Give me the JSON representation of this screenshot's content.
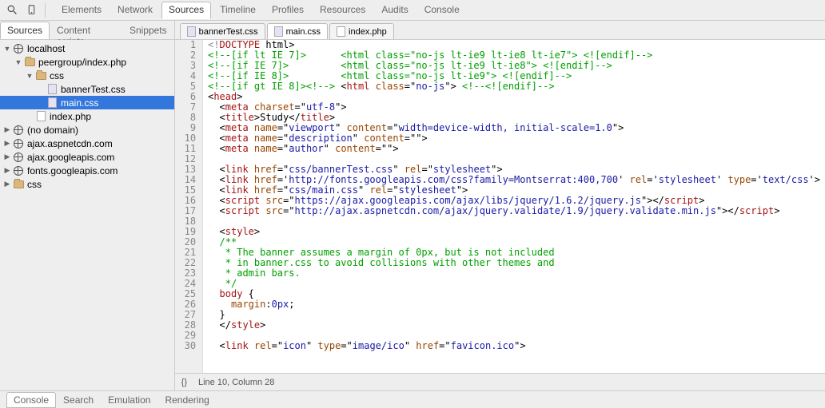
{
  "toolbar": {
    "tabs": [
      "Elements",
      "Network",
      "Sources",
      "Timeline",
      "Profiles",
      "Resources",
      "Audits",
      "Console"
    ],
    "active": 2
  },
  "sidebar": {
    "tabs": [
      "Sources",
      "Content scripts",
      "Snippets"
    ],
    "active": 0,
    "tree": [
      {
        "t": "▼",
        "i": "world",
        "d": 0,
        "l": "localhost"
      },
      {
        "t": "▼",
        "i": "fold",
        "d": 1,
        "l": "peergroup/index.php"
      },
      {
        "t": "▼",
        "i": "fold",
        "d": 2,
        "l": "css"
      },
      {
        "t": "",
        "i": "css",
        "d": 3,
        "l": "bannerTest.css"
      },
      {
        "t": "",
        "i": "css",
        "d": 3,
        "l": "main.css",
        "sel": true
      },
      {
        "t": "",
        "i": "file",
        "d": 2,
        "l": "index.php"
      },
      {
        "t": "▶",
        "i": "world",
        "d": 0,
        "l": "(no domain)"
      },
      {
        "t": "▶",
        "i": "world",
        "d": 0,
        "l": "ajax.aspnetcdn.com"
      },
      {
        "t": "▶",
        "i": "world",
        "d": 0,
        "l": "ajax.googleapis.com"
      },
      {
        "t": "▶",
        "i": "world",
        "d": 0,
        "l": "fonts.googleapis.com"
      },
      {
        "t": "▶",
        "i": "fold",
        "d": 0,
        "l": "css"
      }
    ]
  },
  "fileTabs": [
    {
      "label": "bannerTest.css",
      "icon": "css"
    },
    {
      "label": "main.css",
      "icon": "css",
      "active": true
    },
    {
      "label": "index.php",
      "icon": "file"
    }
  ],
  "code": {
    "lines": [
      [
        [
          "doc",
          "<!"
        ],
        [
          "tag",
          "DOCTYPE"
        ],
        [
          "",
          ""
        ],
        [
          "",
          " html>"
        ]
      ],
      [
        [
          "com",
          "<!--[if lt IE 7]>      <html class=\"no-js lt-ie9 lt-ie8 lt-ie7\"> <![endif]-->"
        ]
      ],
      [
        [
          "com",
          "<!--[if IE 7]>         <html class=\"no-js lt-ie9 lt-ie8\"> <![endif]-->"
        ]
      ],
      [
        [
          "com",
          "<!--[if IE 8]>         <html class=\"no-js lt-ie9\"> <![endif]-->"
        ]
      ],
      [
        [
          "com",
          "<!--[if gt IE 8]><!-->"
        ],
        [
          "",
          " <"
        ],
        [
          "tag",
          "html"
        ],
        [
          "",
          " "
        ],
        [
          "at",
          "class"
        ],
        [
          "",
          "=\""
        ],
        [
          "str",
          "no-js"
        ],
        [
          "",
          "\"> "
        ],
        [
          "com",
          "<!--<![endif]-->"
        ]
      ],
      [
        [
          "",
          "<"
        ],
        [
          "tag",
          "head"
        ],
        [
          "",
          ">"
        ]
      ],
      [
        [
          "",
          "  <"
        ],
        [
          "tag",
          "meta"
        ],
        [
          "",
          " "
        ],
        [
          "at",
          "charset"
        ],
        [
          "",
          "=\""
        ],
        [
          "str",
          "utf-8"
        ],
        [
          "",
          "\">"
        ]
      ],
      [
        [
          "",
          "  <"
        ],
        [
          "tag",
          "title"
        ],
        [
          "",
          ">Study</"
        ],
        [
          "tag",
          "title"
        ],
        [
          "",
          ">"
        ]
      ],
      [
        [
          "",
          "  <"
        ],
        [
          "tag",
          "meta"
        ],
        [
          "",
          " "
        ],
        [
          "at",
          "name"
        ],
        [
          "",
          "=\""
        ],
        [
          "str",
          "viewport"
        ],
        [
          "",
          "\" "
        ],
        [
          "at",
          "content"
        ],
        [
          "",
          "=\""
        ],
        [
          "str",
          "width=device-width, initial-scale=1.0"
        ],
        [
          "",
          "\">"
        ]
      ],
      [
        [
          "",
          "  <"
        ],
        [
          "tag",
          "meta"
        ],
        [
          "",
          " "
        ],
        [
          "at",
          "name"
        ],
        [
          "",
          "=\""
        ],
        [
          "str",
          "description"
        ],
        [
          "",
          "\" "
        ],
        [
          "at",
          "content"
        ],
        [
          "",
          "=\"\">"
        ]
      ],
      [
        [
          "",
          "  <"
        ],
        [
          "tag",
          "meta"
        ],
        [
          "",
          " "
        ],
        [
          "at",
          "name"
        ],
        [
          "",
          "=\""
        ],
        [
          "str",
          "author"
        ],
        [
          "",
          "\" "
        ],
        [
          "at",
          "content"
        ],
        [
          "",
          "=\"\">"
        ]
      ],
      [
        [
          "",
          ""
        ]
      ],
      [
        [
          "",
          "  <"
        ],
        [
          "tag",
          "link"
        ],
        [
          "",
          " "
        ],
        [
          "at",
          "href"
        ],
        [
          "",
          "=\""
        ],
        [
          "str",
          "css/bannerTest.css"
        ],
        [
          "",
          "\" "
        ],
        [
          "at",
          "rel"
        ],
        [
          "",
          "=\""
        ],
        [
          "str",
          "stylesheet"
        ],
        [
          "",
          "\">"
        ]
      ],
      [
        [
          "",
          "  <"
        ],
        [
          "tag",
          "link"
        ],
        [
          "",
          " "
        ],
        [
          "at",
          "href"
        ],
        [
          "",
          "='"
        ],
        [
          "str",
          "http://fonts.googleapis.com/css?family=Montserrat:400,700"
        ],
        [
          "",
          "' "
        ],
        [
          "at",
          "rel"
        ],
        [
          "",
          "='"
        ],
        [
          "str",
          "stylesheet"
        ],
        [
          "",
          "' "
        ],
        [
          "at",
          "type"
        ],
        [
          "",
          "='"
        ],
        [
          "str",
          "text/css"
        ],
        [
          "",
          "'>"
        ]
      ],
      [
        [
          "",
          "  <"
        ],
        [
          "tag",
          "link"
        ],
        [
          "",
          " "
        ],
        [
          "at",
          "href"
        ],
        [
          "",
          "=\""
        ],
        [
          "str",
          "css/main.css"
        ],
        [
          "",
          "\" "
        ],
        [
          "at",
          "rel"
        ],
        [
          "",
          "=\""
        ],
        [
          "str",
          "stylesheet"
        ],
        [
          "",
          "\">"
        ]
      ],
      [
        [
          "",
          "  <"
        ],
        [
          "tag",
          "script"
        ],
        [
          "",
          " "
        ],
        [
          "at",
          "src"
        ],
        [
          "",
          "=\""
        ],
        [
          "str",
          "https://ajax.googleapis.com/ajax/libs/jquery/1.6.2/jquery.js"
        ],
        [
          "",
          "\"></"
        ],
        [
          "tag",
          "script"
        ],
        [
          "",
          ">"
        ]
      ],
      [
        [
          "",
          "  <"
        ],
        [
          "tag",
          "script"
        ],
        [
          "",
          " "
        ],
        [
          "at",
          "src"
        ],
        [
          "",
          "=\""
        ],
        [
          "str",
          "http://ajax.aspnetcdn.com/ajax/jquery.validate/1.9/jquery.validate.min.js"
        ],
        [
          "",
          "\"></"
        ],
        [
          "tag",
          "script"
        ],
        [
          "",
          ">"
        ]
      ],
      [
        [
          "",
          ""
        ]
      ],
      [
        [
          "",
          "  <"
        ],
        [
          "tag",
          "style"
        ],
        [
          "",
          ">"
        ]
      ],
      [
        [
          "com",
          "  /**"
        ]
      ],
      [
        [
          "com",
          "   * The banner assumes a margin of 0px, but is not included"
        ]
      ],
      [
        [
          "com",
          "   * in banner.css to avoid collisions with other themes and"
        ]
      ],
      [
        [
          "com",
          "   * admin bars."
        ]
      ],
      [
        [
          "com",
          "   */"
        ]
      ],
      [
        [
          "sel",
          "  body"
        ],
        [
          "",
          " {"
        ]
      ],
      [
        [
          "",
          "    "
        ],
        [
          "prop",
          "margin"
        ],
        [
          "",
          ":"
        ],
        [
          "num",
          "0px"
        ],
        [
          "",
          ";"
        ]
      ],
      [
        [
          "",
          "  }"
        ]
      ],
      [
        [
          "",
          "  </"
        ],
        [
          "tag",
          "style"
        ],
        [
          "",
          ">"
        ]
      ],
      [
        [
          "",
          ""
        ]
      ],
      [
        [
          "",
          "  <"
        ],
        [
          "tag",
          "link"
        ],
        [
          "",
          " "
        ],
        [
          "at",
          "rel"
        ],
        [
          "",
          "=\""
        ],
        [
          "str",
          "icon"
        ],
        [
          "",
          "\" "
        ],
        [
          "at",
          "type"
        ],
        [
          "",
          "=\""
        ],
        [
          "str",
          "image/ico"
        ],
        [
          "",
          "\" "
        ],
        [
          "at",
          "href"
        ],
        [
          "",
          "=\""
        ],
        [
          "str",
          "favicon.ico"
        ],
        [
          "",
          "\">"
        ]
      ]
    ]
  },
  "status": {
    "cursor": "Line 10, Column 28",
    "braces": "{}"
  },
  "footer": {
    "tabs": [
      "Console",
      "Search",
      "Emulation",
      "Rendering"
    ],
    "active": 0
  }
}
